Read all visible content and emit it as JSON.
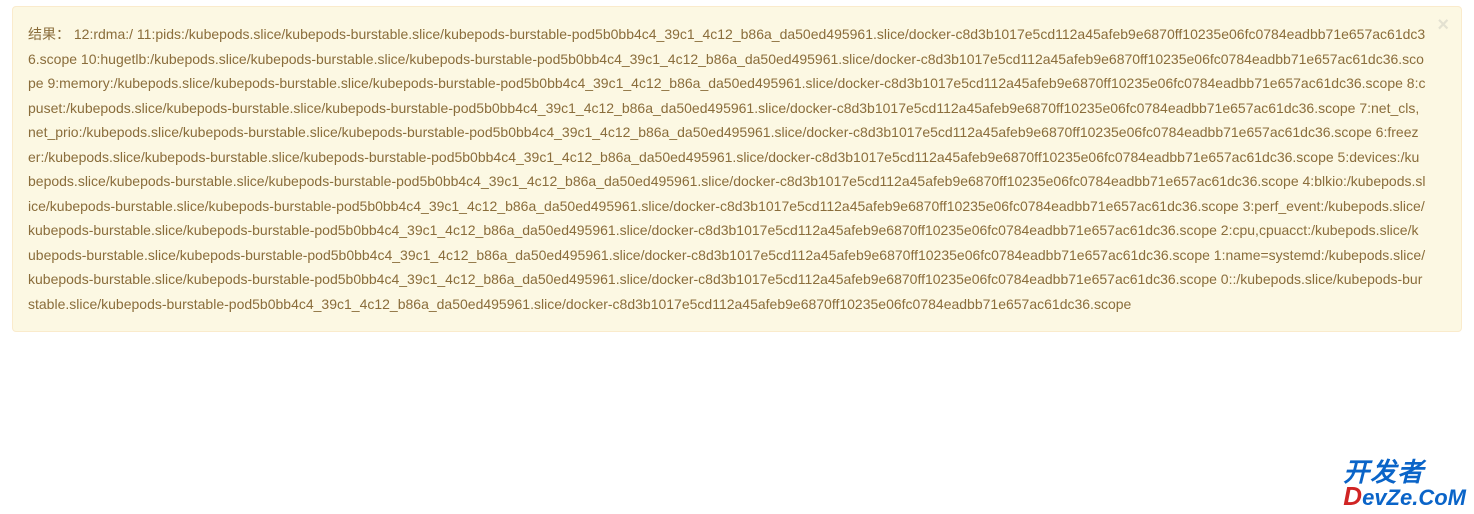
{
  "alert": {
    "prefix": "结果：",
    "body": "12:rdma:/ 11:pids:/kubepods.slice/kubepods-burstable.slice/kubepods-burstable-pod5b0bb4c4_39c1_4c12_b86a_da50ed495961.slice/docker-c8d3b1017e5cd112a45afeb9e6870ff10235e06fc0784eadbb71e657ac61dc36.scope 10:hugetlb:/kubepods.slice/kubepods-burstable.slice/kubepods-burstable-pod5b0bb4c4_39c1_4c12_b86a_da50ed495961.slice/docker-c8d3b1017e5cd112a45afeb9e6870ff10235e06fc0784eadbb71e657ac61dc36.scope 9:memory:/kubepods.slice/kubepods-burstable.slice/kubepods-burstable-pod5b0bb4c4_39c1_4c12_b86a_da50ed495961.slice/docker-c8d3b1017e5cd112a45afeb9e6870ff10235e06fc0784eadbb71e657ac61dc36.scope 8:cpuset:/kubepods.slice/kubepods-burstable.slice/kubepods-burstable-pod5b0bb4c4_39c1_4c12_b86a_da50ed495961.slice/docker-c8d3b1017e5cd112a45afeb9e6870ff10235e06fc0784eadbb71e657ac61dc36.scope 7:net_cls,net_prio:/kubepods.slice/kubepods-burstable.slice/kubepods-burstable-pod5b0bb4c4_39c1_4c12_b86a_da50ed495961.slice/docker-c8d3b1017e5cd112a45afeb9e6870ff10235e06fc0784eadbb71e657ac61dc36.scope 6:freezer:/kubepods.slice/kubepods-burstable.slice/kubepods-burstable-pod5b0bb4c4_39c1_4c12_b86a_da50ed495961.slice/docker-c8d3b1017e5cd112a45afeb9e6870ff10235e06fc0784eadbb71e657ac61dc36.scope 5:devices:/kubepods.slice/kubepods-burstable.slice/kubepods-burstable-pod5b0bb4c4_39c1_4c12_b86a_da50ed495961.slice/docker-c8d3b1017e5cd112a45afeb9e6870ff10235e06fc0784eadbb71e657ac61dc36.scope 4:blkio:/kubepods.slice/kubepods-burstable.slice/kubepods-burstable-pod5b0bb4c4_39c1_4c12_b86a_da50ed495961.slice/docker-c8d3b1017e5cd112a45afeb9e6870ff10235e06fc0784eadbb71e657ac61dc36.scope 3:perf_event:/kubepods.slice/kubepods-burstable.slice/kubepods-burstable-pod5b0bb4c4_39c1_4c12_b86a_da50ed495961.slice/docker-c8d3b1017e5cd112a45afeb9e6870ff10235e06fc0784eadbb71e657ac61dc36.scope 2:cpu,cpuacct:/kubepods.slice/kubepods-burstable.slice/kubepods-burstable-pod5b0bb4c4_39c1_4c12_b86a_da50ed495961.slice/docker-c8d3b1017e5cd112a45afeb9e6870ff10235e06fc0784eadbb71e657ac61dc36.scope 1:name=systemd:/kubepods.slice/kubepods-burstable.slice/kubepods-burstable-pod5b0bb4c4_39c1_4c12_b86a_da50ed495961.slice/docker-c8d3b1017e5cd112a45afeb9e6870ff10235e06fc0784eadbb71e657ac61dc36.scope 0::/kubepods.slice/kubepods-burstable.slice/kubepods-burstable-pod5b0bb4c4_39c1_4c12_b86a_da50ed495961.slice/docker-c8d3b1017e5cd112a45afeb9e6870ff10235e06fc0784eadbb71e657ac61dc36.scope",
    "close_glyph": "×"
  },
  "watermark": {
    "top": "开发者",
    "bottom_first": "D",
    "bottom_rest": "evZe.CoM"
  }
}
